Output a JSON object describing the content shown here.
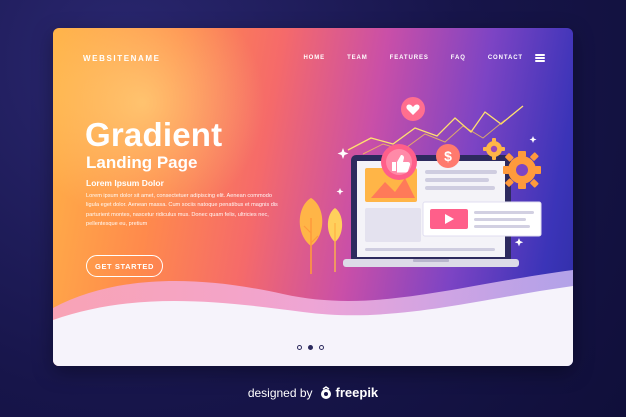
{
  "nav": {
    "brand": "WEBSITENAME",
    "items": [
      {
        "label": "HOME"
      },
      {
        "label": "TEAM"
      },
      {
        "label": "FEATURES"
      },
      {
        "label": "FAQ"
      },
      {
        "label": "CONTACT"
      }
    ]
  },
  "hero": {
    "title": "Gradient",
    "subtitle": "Landing Page",
    "tagline": "Lorem Ipsum Dolor",
    "body": "Lorem ipsum dolor sit amet, consectetuer adipiscing elit. Aenean commodo ligula eget dolor. Aenean massa. Cum sociis natoque penatibus et magnis dis parturient montes, nascetur ridiculus mus. Donec quam felis, ultricies nec, pellentesque eu, pretium",
    "cta_label": "GET STARTED"
  },
  "slider": {
    "count": 3,
    "active_index": 1
  },
  "credit": {
    "prefix": "designed by",
    "brand": "freepik"
  },
  "colors": {
    "navy": "#17154a",
    "wave_dark": "#2d2a5e",
    "accent_pink": "#ff5f8a",
    "accent_orange": "#ff9a3c",
    "accent_yellow": "#ffd966"
  },
  "icons": [
    "hamburger-menu-icon",
    "heart-icon",
    "like-icon",
    "dollar-icon",
    "gear-icon",
    "play-icon",
    "sparkle-icon",
    "freepik-logo-icon"
  ]
}
